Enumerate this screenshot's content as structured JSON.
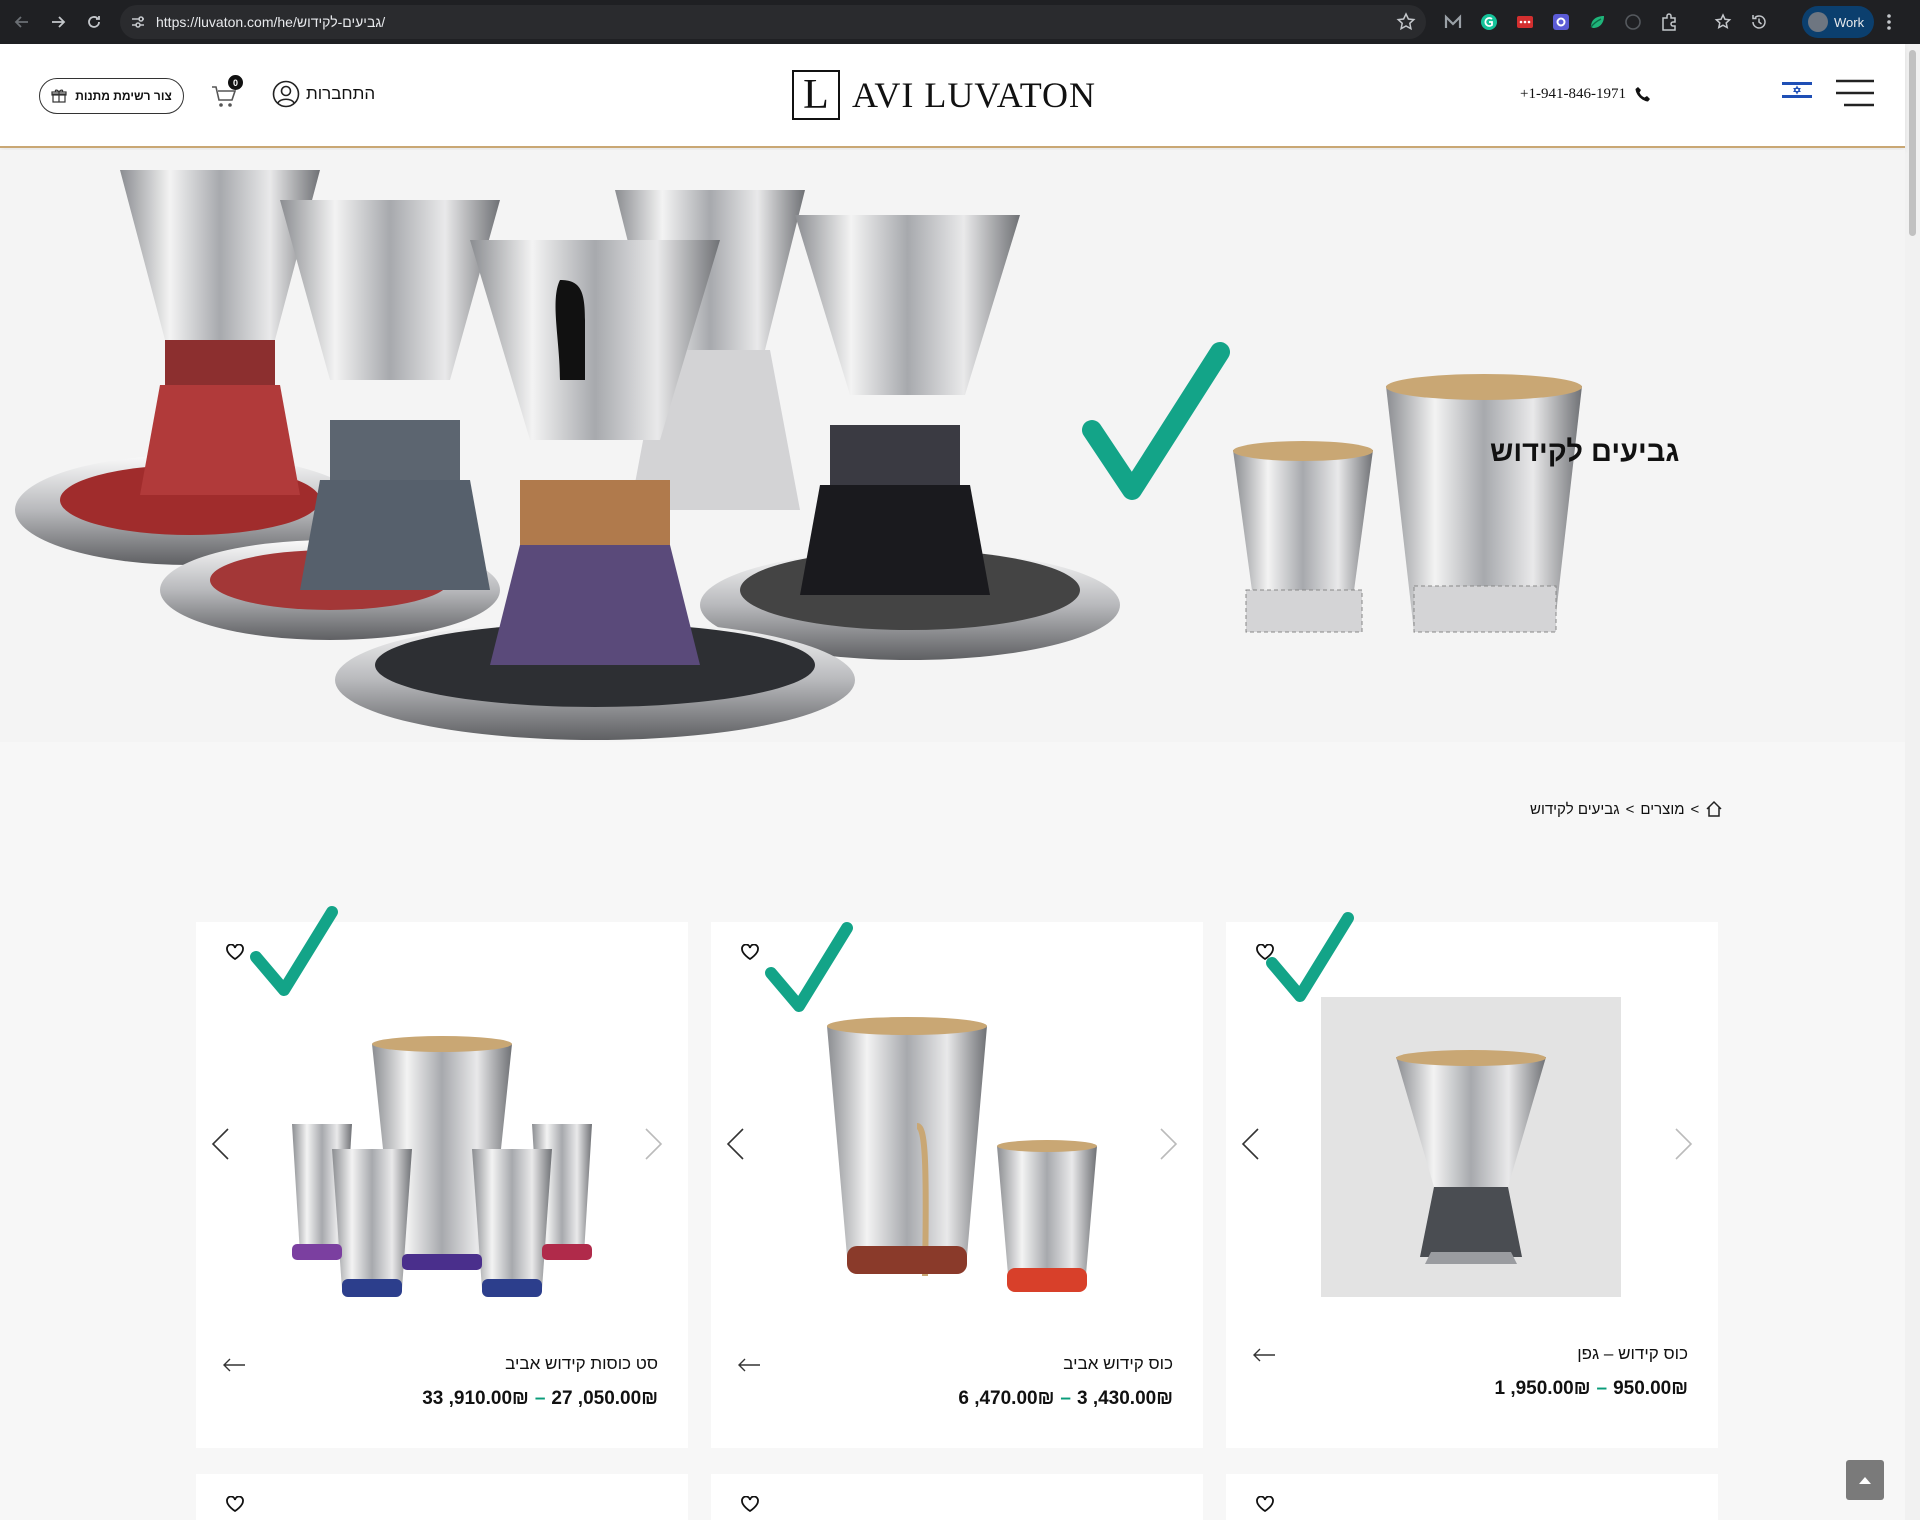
{
  "browser": {
    "url": "https://luvaton.com/he/גביעים-לקידוש/",
    "profile_label": "Work"
  },
  "header": {
    "gift_list_label": "צור רשימת מתנות",
    "cart_count": "0",
    "login_label": "התחברות",
    "logo_letter": "L",
    "logo_text": "AVI LUVATON",
    "phone": "+1-941-846-1971"
  },
  "hero": {
    "title": "גביעים לקידוש"
  },
  "breadcrumb": {
    "products": "מוצרים",
    "separator": ">",
    "current": "גביעים לקידוש"
  },
  "products": [
    {
      "name": "סט כוסות קידוש אביב",
      "price_min": "27 ,050.00₪",
      "price_max": "33 ,910.00₪"
    },
    {
      "name": "כוס קידוש אביב",
      "price_min": "3 ,430.00₪",
      "price_max": "6 ,470.00₪"
    },
    {
      "name": "כוס קידוש – גפן",
      "price_min": "950.00₪",
      "price_max": "1 ,950.00₪"
    }
  ],
  "colors": {
    "accent_gold": "#c9a774",
    "check_green": "#13a488",
    "price_dash": "#0a9c7a"
  }
}
